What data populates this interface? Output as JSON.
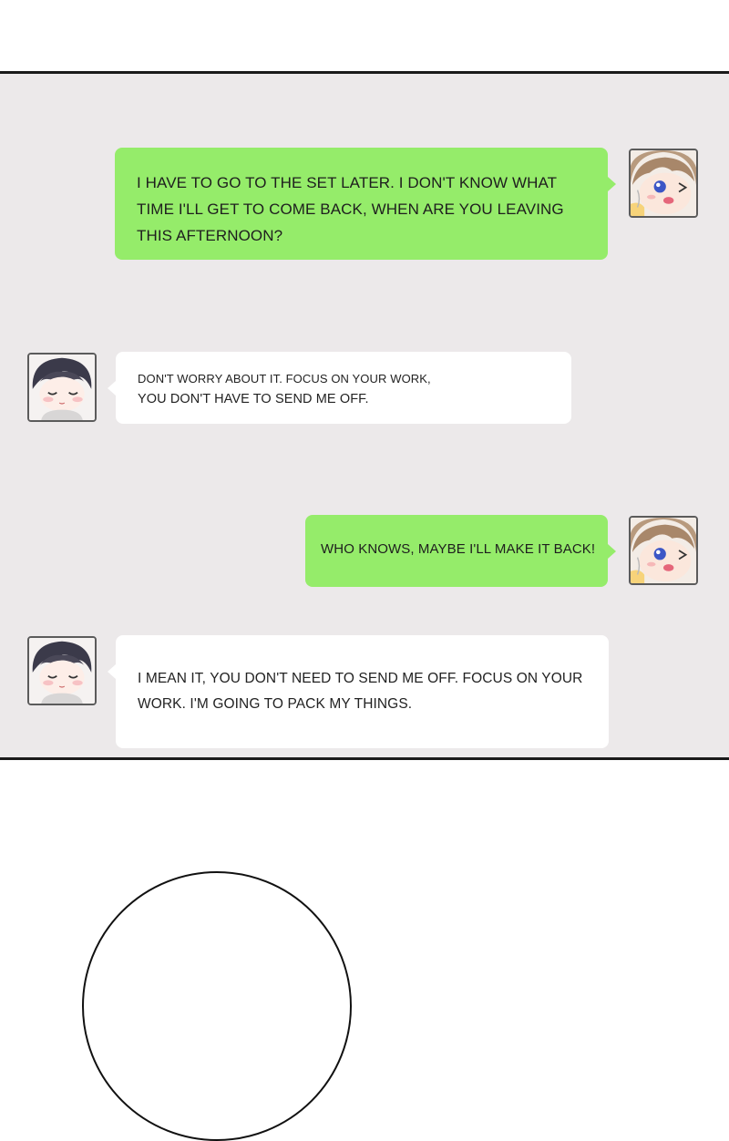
{
  "colors": {
    "panel_background": "#ece9ea",
    "sent_bubble": "#95ec6a",
    "received_bubble": "#ffffff",
    "border": "#1a1a1a"
  },
  "messages": [
    {
      "sender": "blond-boy",
      "side": "right",
      "lines": [
        "I HAVE TO GO TO THE SET LATER. I DON'T KNOW WHAT",
        "TIME I'LL GET TO COME BACK, WHEN ARE YOU LEAVING",
        "THIS AFTERNOON?"
      ]
    },
    {
      "sender": "dark-haired-boy",
      "side": "left",
      "lines": [
        "DON'T WORRY ABOUT IT. FOCUS ON YOUR WORK,",
        "YOU DON'T HAVE TO SEND ME OFF."
      ]
    },
    {
      "sender": "blond-boy",
      "side": "right",
      "lines": [
        "WHO KNOWS, MAYBE I'LL MAKE IT BACK!"
      ]
    },
    {
      "sender": "dark-haired-boy",
      "side": "left",
      "lines": [
        "I MEAN IT, YOU DON'T NEED TO SEND ME OFF. FOCUS ON YOUR",
        "WORK. I'M GOING TO PACK MY THINGS."
      ]
    }
  ],
  "avatars": {
    "blond_boy_icon": "winking-blond-boy-avatar",
    "dark_haired_boy_icon": "smiling-dark-haired-boy-avatar"
  }
}
